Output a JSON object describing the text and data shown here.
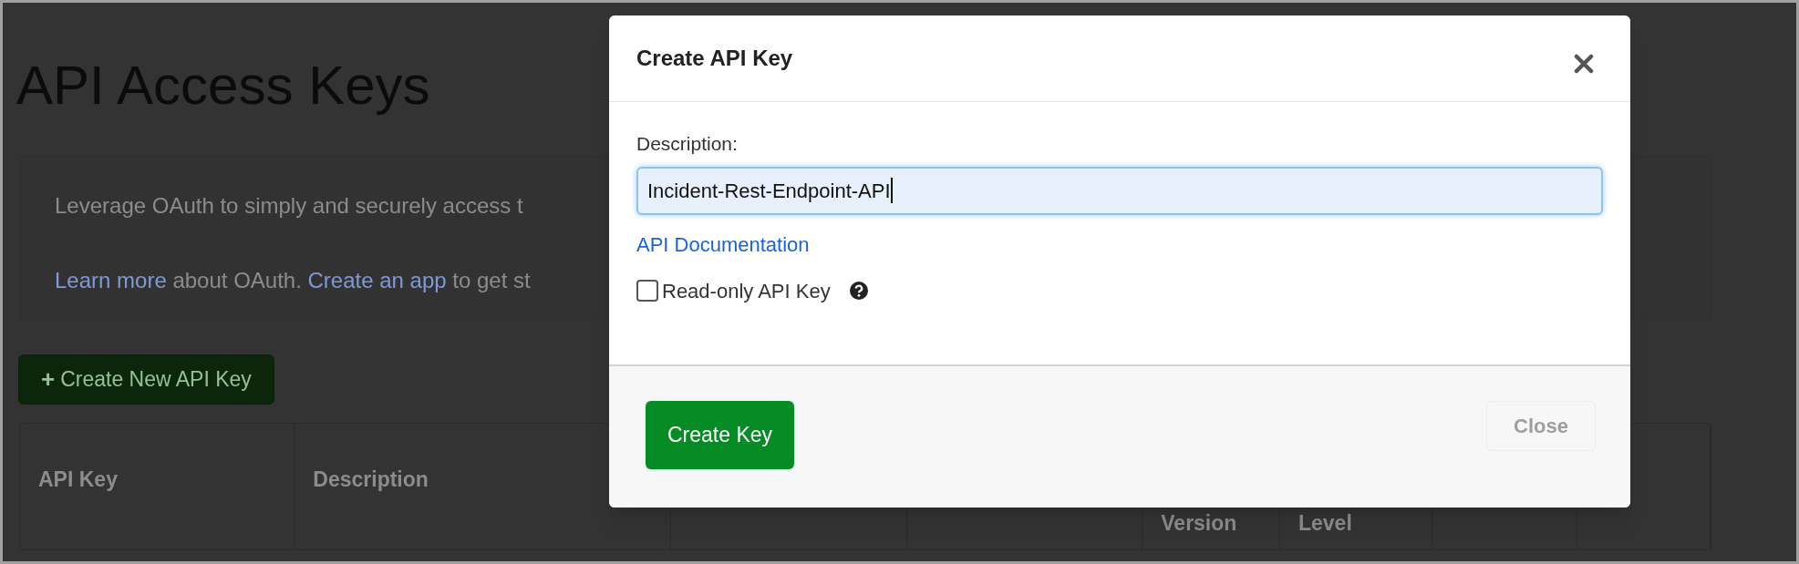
{
  "page": {
    "title": "API Access Keys",
    "info": {
      "text": "Leverage OAuth to simply and securely access t",
      "line2": [
        {
          "kind": "link",
          "text": "Learn more"
        },
        {
          "kind": "text",
          "text": " about OAuth. "
        },
        {
          "kind": "link",
          "text": "Create an app"
        },
        {
          "kind": "text",
          "text": " to get st"
        }
      ]
    },
    "create_button": {
      "icon": "+",
      "label": "Create New API Key"
    },
    "table": {
      "columns": [
        {
          "label": "API Key"
        },
        {
          "label": "Description"
        },
        {},
        {},
        {
          "label": "Version"
        },
        {
          "label": "Level"
        },
        {},
        {}
      ]
    }
  },
  "dialog": {
    "title": "Create API Key",
    "field": {
      "label": "Description:",
      "value": "Incident-Rest-Endpoint-API",
      "focused": true
    },
    "link": "API Documentation",
    "checkbox": {
      "label": "Read-only API Key",
      "checked": false
    },
    "buttons": [
      {
        "label": "Create Key",
        "kind": "primary",
        "disabled": false
      },
      {
        "label": "Close",
        "kind": "secondary",
        "disabled": true
      }
    ]
  }
}
